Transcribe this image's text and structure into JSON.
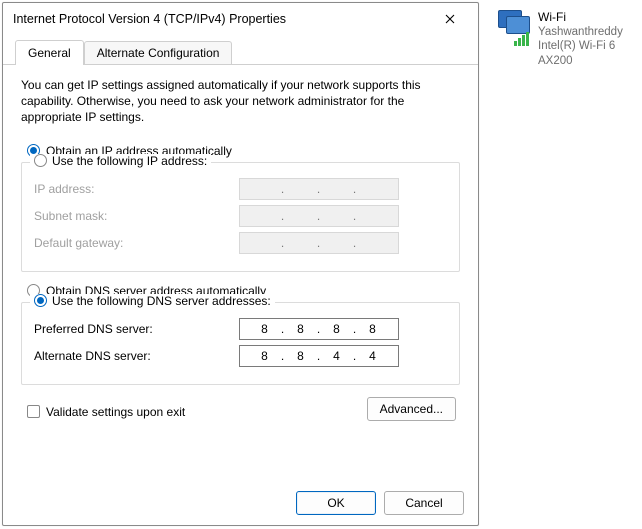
{
  "dialog": {
    "title": "Internet Protocol Version 4 (TCP/IPv4) Properties",
    "tabs": {
      "general": "General",
      "alt": "Alternate Configuration"
    },
    "description": "You can get IP settings assigned automatically if your network supports this capability. Otherwise, you need to ask your network administrator for the appropriate IP settings.",
    "ip_section": {
      "auto_label": "Obtain an IP address automatically",
      "manual_label": "Use the following IP address:",
      "mode": "auto",
      "fields": {
        "ip_label": "IP address:",
        "subnet_label": "Subnet mask:",
        "gateway_label": "Default gateway:",
        "ip": [
          "",
          "",
          "",
          ""
        ],
        "subnet": [
          "",
          "",
          "",
          ""
        ],
        "gateway": [
          "",
          "",
          "",
          ""
        ]
      }
    },
    "dns_section": {
      "auto_label": "Obtain DNS server address automatically",
      "manual_label": "Use the following DNS server addresses:",
      "mode": "manual",
      "fields": {
        "preferred_label": "Preferred DNS server:",
        "alternate_label": "Alternate DNS server:",
        "preferred": [
          "8",
          "8",
          "8",
          "8"
        ],
        "alternate": [
          "8",
          "8",
          "4",
          "4"
        ]
      }
    },
    "validate_label": "Validate settings upon exit",
    "validate_checked": false,
    "advanced_label": "Advanced...",
    "ok_label": "OK",
    "cancel_label": "Cancel"
  },
  "adapter": {
    "name": "Wi-Fi",
    "line2": "Yashwanthreddy",
    "line3": "Intel(R) Wi-Fi 6 AX200"
  }
}
